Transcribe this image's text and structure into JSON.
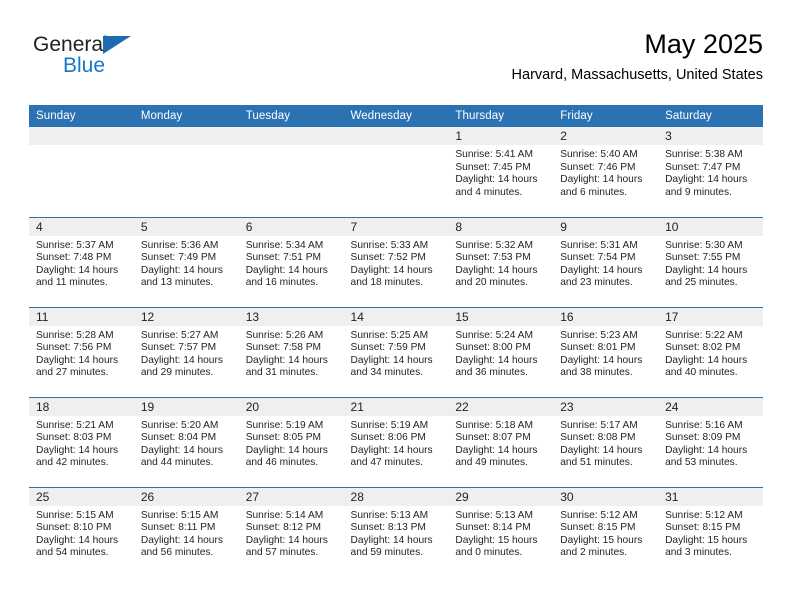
{
  "brand": {
    "name_part1": "General",
    "name_part2": "Blue",
    "triangle_color": "#1f6bb0",
    "blue_color": "#1578cf"
  },
  "header": {
    "title": "May 2025",
    "subtitle": "Harvard, Massachusetts, United States"
  },
  "theme": {
    "header_bg": "#2b72b3",
    "day_band_bg": "#efefef",
    "divider": "#2b72b3",
    "text": "#231f20"
  },
  "weekday_headers": [
    "Sunday",
    "Monday",
    "Tuesday",
    "Wednesday",
    "Thursday",
    "Friday",
    "Saturday"
  ],
  "weeks": [
    [
      {
        "empty": true,
        "day": "",
        "sunrise": "",
        "sunset": "",
        "daylight_line1": "",
        "daylight_line2": ""
      },
      {
        "empty": true,
        "day": "",
        "sunrise": "",
        "sunset": "",
        "daylight_line1": "",
        "daylight_line2": ""
      },
      {
        "empty": true,
        "day": "",
        "sunrise": "",
        "sunset": "",
        "daylight_line1": "",
        "daylight_line2": ""
      },
      {
        "empty": true,
        "day": "",
        "sunrise": "",
        "sunset": "",
        "daylight_line1": "",
        "daylight_line2": ""
      },
      {
        "empty": false,
        "day": "1",
        "sunrise": "Sunrise: 5:41 AM",
        "sunset": "Sunset: 7:45 PM",
        "daylight_line1": "Daylight: 14 hours",
        "daylight_line2": "and 4 minutes."
      },
      {
        "empty": false,
        "day": "2",
        "sunrise": "Sunrise: 5:40 AM",
        "sunset": "Sunset: 7:46 PM",
        "daylight_line1": "Daylight: 14 hours",
        "daylight_line2": "and 6 minutes."
      },
      {
        "empty": false,
        "day": "3",
        "sunrise": "Sunrise: 5:38 AM",
        "sunset": "Sunset: 7:47 PM",
        "daylight_line1": "Daylight: 14 hours",
        "daylight_line2": "and 9 minutes."
      }
    ],
    [
      {
        "empty": false,
        "day": "4",
        "sunrise": "Sunrise: 5:37 AM",
        "sunset": "Sunset: 7:48 PM",
        "daylight_line1": "Daylight: 14 hours",
        "daylight_line2": "and 11 minutes."
      },
      {
        "empty": false,
        "day": "5",
        "sunrise": "Sunrise: 5:36 AM",
        "sunset": "Sunset: 7:49 PM",
        "daylight_line1": "Daylight: 14 hours",
        "daylight_line2": "and 13 minutes."
      },
      {
        "empty": false,
        "day": "6",
        "sunrise": "Sunrise: 5:34 AM",
        "sunset": "Sunset: 7:51 PM",
        "daylight_line1": "Daylight: 14 hours",
        "daylight_line2": "and 16 minutes."
      },
      {
        "empty": false,
        "day": "7",
        "sunrise": "Sunrise: 5:33 AM",
        "sunset": "Sunset: 7:52 PM",
        "daylight_line1": "Daylight: 14 hours",
        "daylight_line2": "and 18 minutes."
      },
      {
        "empty": false,
        "day": "8",
        "sunrise": "Sunrise: 5:32 AM",
        "sunset": "Sunset: 7:53 PM",
        "daylight_line1": "Daylight: 14 hours",
        "daylight_line2": "and 20 minutes."
      },
      {
        "empty": false,
        "day": "9",
        "sunrise": "Sunrise: 5:31 AM",
        "sunset": "Sunset: 7:54 PM",
        "daylight_line1": "Daylight: 14 hours",
        "daylight_line2": "and 23 minutes."
      },
      {
        "empty": false,
        "day": "10",
        "sunrise": "Sunrise: 5:30 AM",
        "sunset": "Sunset: 7:55 PM",
        "daylight_line1": "Daylight: 14 hours",
        "daylight_line2": "and 25 minutes."
      }
    ],
    [
      {
        "empty": false,
        "day": "11",
        "sunrise": "Sunrise: 5:28 AM",
        "sunset": "Sunset: 7:56 PM",
        "daylight_line1": "Daylight: 14 hours",
        "daylight_line2": "and 27 minutes."
      },
      {
        "empty": false,
        "day": "12",
        "sunrise": "Sunrise: 5:27 AM",
        "sunset": "Sunset: 7:57 PM",
        "daylight_line1": "Daylight: 14 hours",
        "daylight_line2": "and 29 minutes."
      },
      {
        "empty": false,
        "day": "13",
        "sunrise": "Sunrise: 5:26 AM",
        "sunset": "Sunset: 7:58 PM",
        "daylight_line1": "Daylight: 14 hours",
        "daylight_line2": "and 31 minutes."
      },
      {
        "empty": false,
        "day": "14",
        "sunrise": "Sunrise: 5:25 AM",
        "sunset": "Sunset: 7:59 PM",
        "daylight_line1": "Daylight: 14 hours",
        "daylight_line2": "and 34 minutes."
      },
      {
        "empty": false,
        "day": "15",
        "sunrise": "Sunrise: 5:24 AM",
        "sunset": "Sunset: 8:00 PM",
        "daylight_line1": "Daylight: 14 hours",
        "daylight_line2": "and 36 minutes."
      },
      {
        "empty": false,
        "day": "16",
        "sunrise": "Sunrise: 5:23 AM",
        "sunset": "Sunset: 8:01 PM",
        "daylight_line1": "Daylight: 14 hours",
        "daylight_line2": "and 38 minutes."
      },
      {
        "empty": false,
        "day": "17",
        "sunrise": "Sunrise: 5:22 AM",
        "sunset": "Sunset: 8:02 PM",
        "daylight_line1": "Daylight: 14 hours",
        "daylight_line2": "and 40 minutes."
      }
    ],
    [
      {
        "empty": false,
        "day": "18",
        "sunrise": "Sunrise: 5:21 AM",
        "sunset": "Sunset: 8:03 PM",
        "daylight_line1": "Daylight: 14 hours",
        "daylight_line2": "and 42 minutes."
      },
      {
        "empty": false,
        "day": "19",
        "sunrise": "Sunrise: 5:20 AM",
        "sunset": "Sunset: 8:04 PM",
        "daylight_line1": "Daylight: 14 hours",
        "daylight_line2": "and 44 minutes."
      },
      {
        "empty": false,
        "day": "20",
        "sunrise": "Sunrise: 5:19 AM",
        "sunset": "Sunset: 8:05 PM",
        "daylight_line1": "Daylight: 14 hours",
        "daylight_line2": "and 46 minutes."
      },
      {
        "empty": false,
        "day": "21",
        "sunrise": "Sunrise: 5:19 AM",
        "sunset": "Sunset: 8:06 PM",
        "daylight_line1": "Daylight: 14 hours",
        "daylight_line2": "and 47 minutes."
      },
      {
        "empty": false,
        "day": "22",
        "sunrise": "Sunrise: 5:18 AM",
        "sunset": "Sunset: 8:07 PM",
        "daylight_line1": "Daylight: 14 hours",
        "daylight_line2": "and 49 minutes."
      },
      {
        "empty": false,
        "day": "23",
        "sunrise": "Sunrise: 5:17 AM",
        "sunset": "Sunset: 8:08 PM",
        "daylight_line1": "Daylight: 14 hours",
        "daylight_line2": "and 51 minutes."
      },
      {
        "empty": false,
        "day": "24",
        "sunrise": "Sunrise: 5:16 AM",
        "sunset": "Sunset: 8:09 PM",
        "daylight_line1": "Daylight: 14 hours",
        "daylight_line2": "and 53 minutes."
      }
    ],
    [
      {
        "empty": false,
        "day": "25",
        "sunrise": "Sunrise: 5:15 AM",
        "sunset": "Sunset: 8:10 PM",
        "daylight_line1": "Daylight: 14 hours",
        "daylight_line2": "and 54 minutes."
      },
      {
        "empty": false,
        "day": "26",
        "sunrise": "Sunrise: 5:15 AM",
        "sunset": "Sunset: 8:11 PM",
        "daylight_line1": "Daylight: 14 hours",
        "daylight_line2": "and 56 minutes."
      },
      {
        "empty": false,
        "day": "27",
        "sunrise": "Sunrise: 5:14 AM",
        "sunset": "Sunset: 8:12 PM",
        "daylight_line1": "Daylight: 14 hours",
        "daylight_line2": "and 57 minutes."
      },
      {
        "empty": false,
        "day": "28",
        "sunrise": "Sunrise: 5:13 AM",
        "sunset": "Sunset: 8:13 PM",
        "daylight_line1": "Daylight: 14 hours",
        "daylight_line2": "and 59 minutes."
      },
      {
        "empty": false,
        "day": "29",
        "sunrise": "Sunrise: 5:13 AM",
        "sunset": "Sunset: 8:14 PM",
        "daylight_line1": "Daylight: 15 hours",
        "daylight_line2": "and 0 minutes."
      },
      {
        "empty": false,
        "day": "30",
        "sunrise": "Sunrise: 5:12 AM",
        "sunset": "Sunset: 8:15 PM",
        "daylight_line1": "Daylight: 15 hours",
        "daylight_line2": "and 2 minutes."
      },
      {
        "empty": false,
        "day": "31",
        "sunrise": "Sunrise: 5:12 AM",
        "sunset": "Sunset: 8:15 PM",
        "daylight_line1": "Daylight: 15 hours",
        "daylight_line2": "and 3 minutes."
      }
    ]
  ]
}
